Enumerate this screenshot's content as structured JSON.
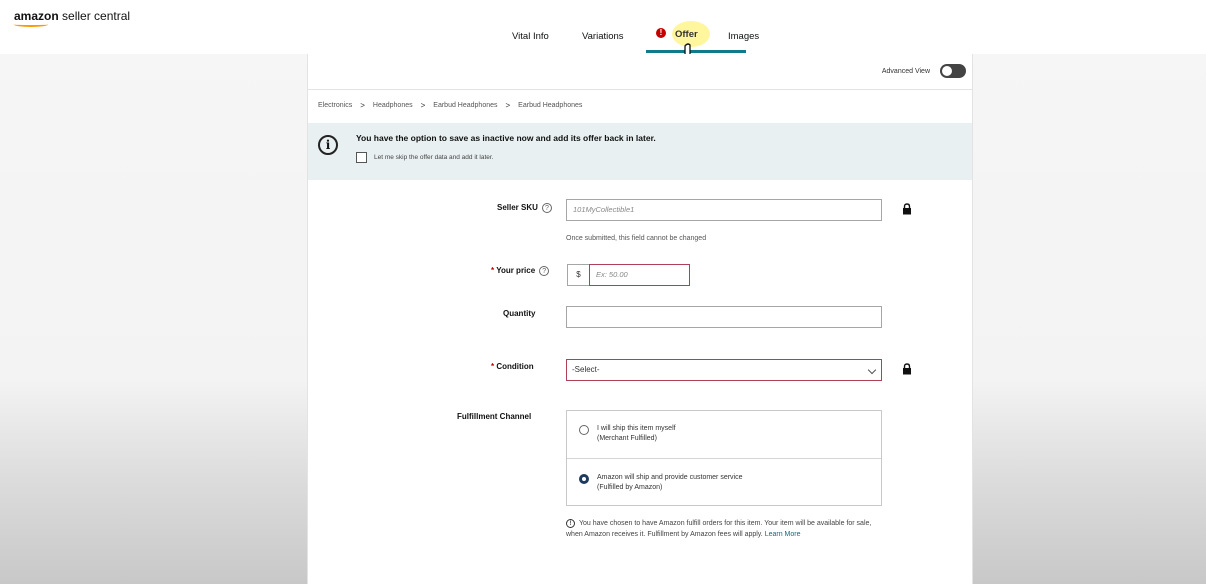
{
  "app": {
    "logo_bold": "amazon",
    "logo_rest": " seller central"
  },
  "tabs": [
    {
      "label": "Vital Info"
    },
    {
      "label": "Variations"
    },
    {
      "label": "Offer",
      "active": true,
      "has_error": true,
      "error_badge": "!"
    },
    {
      "label": "Images"
    }
  ],
  "header": {
    "advanced_view_label": "Advanced View",
    "advanced_view_on": false
  },
  "breadcrumb": [
    "Electronics",
    "Headphones",
    "Earbud Headphones",
    "Earbud Headphones"
  ],
  "breadcrumb_separator": ">",
  "banner": {
    "icon": "i",
    "title": "You have the option to save as inactive now and add its offer back in later.",
    "checkbox_label": "Let me skip the offer data and add it later."
  },
  "form": {
    "seller_sku": {
      "label": "Seller SKU",
      "help": "?",
      "placeholder": "101MyCollectible1",
      "hint": "Once submitted, this field cannot be changed"
    },
    "price": {
      "required_mark": "*",
      "label": "Your price",
      "help": "?",
      "currency": "$",
      "placeholder": "Ex: 50.00"
    },
    "quantity": {
      "label": "Quantity",
      "value": ""
    },
    "condition": {
      "required_mark": "*",
      "label": "Condition",
      "selected": "-Select-"
    },
    "fulfillment": {
      "label": "Fulfillment Channel",
      "options": [
        {
          "line1": "I will ship this item myself",
          "line2": "(Merchant Fulfilled)",
          "selected": false
        },
        {
          "line1": "Amazon will ship and provide customer service",
          "line2": "(Fulfilled by Amazon)",
          "selected": true
        }
      ],
      "note_icon": "!",
      "note": "You have chosen to have Amazon fulfill orders for this item. Your item will be available for sale, when Amazon receives it. Fulfillment by Amazon fees will apply.",
      "learn_more": "Learn More"
    }
  },
  "colors": {
    "accent": "#0f7b8a",
    "error": "#c40000",
    "banner_bg": "#e8f0f1",
    "logo_smile": "#ff9900"
  }
}
